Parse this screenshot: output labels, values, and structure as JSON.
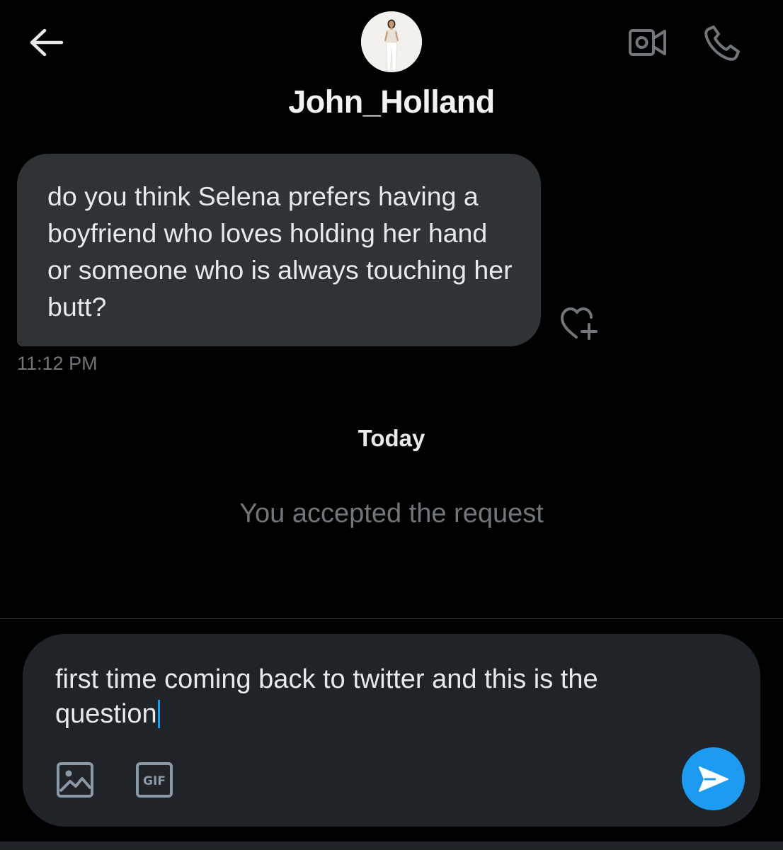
{
  "header": {
    "contact_name": "John_Holland"
  },
  "icons": {
    "back": "arrow-left-icon",
    "video": "video-camera-icon",
    "phone": "phone-icon",
    "react": "heart-plus-icon",
    "media": "image-icon",
    "gif": "gif-icon",
    "send": "send-icon"
  },
  "conversation": {
    "messages": [
      {
        "text": "do you think Selena prefers having a boyfriend who loves holding her hand or someone who is always touching her butt?",
        "time": "11:12 PM"
      }
    ],
    "day_label": "Today",
    "system_message": "You accepted the request"
  },
  "composer": {
    "value": "first time coming back to twitter and this is the question",
    "gif_label": "GIF"
  },
  "colors": {
    "background": "#000000",
    "bubble": "#2f3336",
    "composer": "#202327",
    "accent": "#1d9bf0",
    "muted_text": "#71767b"
  }
}
